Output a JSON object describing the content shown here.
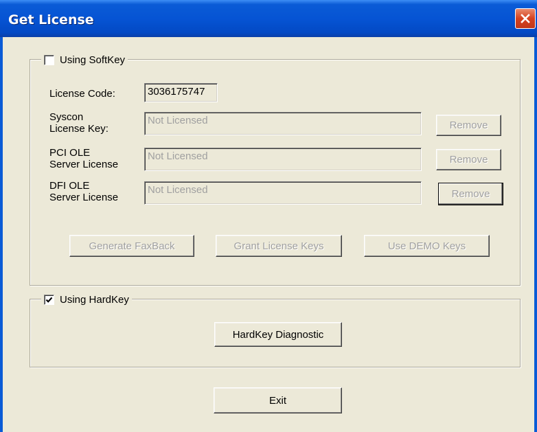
{
  "window": {
    "title": "Get License"
  },
  "softkey": {
    "checkbox_label": "Using SoftKey",
    "checked": false,
    "license_code_label": "License Code:",
    "license_code_value": "3036175747",
    "rows": [
      {
        "label_line1": "Syscon",
        "label_line2": "License Key:",
        "value": "Not Licensed",
        "button": "Remove"
      },
      {
        "label_line1": "PCI OLE",
        "label_line2": "Server License",
        "value": "Not Licensed",
        "button": "Remove"
      },
      {
        "label_line1": "DFI OLE",
        "label_line2": "Server License",
        "value": "Not Licensed",
        "button": "Remove"
      }
    ],
    "actions": {
      "generate": "Generate FaxBack",
      "grant": "Grant License Keys",
      "demo": "Use DEMO Keys"
    }
  },
  "hardkey": {
    "checkbox_label": "Using HardKey",
    "checked": true,
    "diagnostic_button": "HardKey Diagnostic"
  },
  "footer": {
    "exit_button": "Exit"
  }
}
